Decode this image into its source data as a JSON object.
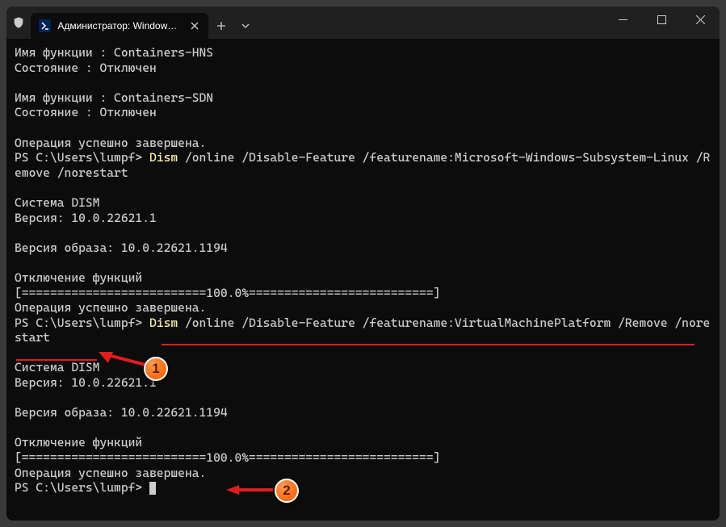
{
  "tab": {
    "title": "Администратор: Windows Po",
    "icon_label": "powershell-icon"
  },
  "window_controls": {
    "minimize": "—",
    "maximize": "▢",
    "close": "✕"
  },
  "annotations": {
    "bubble1": "1",
    "bubble2": "2"
  },
  "terminal": {
    "l1": "Имя функции : Containers-HNS",
    "l2": "Состояние : Отключен",
    "blank1": "",
    "l3": "Имя функции : Containers-SDN",
    "l4": "Состояние : Отключен",
    "blank2": "",
    "l5": "Операция успешно завершена.",
    "p1_prefix": "PS C:\\Users\\lumpf> ",
    "p1_cmd": "Dism",
    "p1_args": " /online /Disable-Feature /featurename:Microsoft-Windows-Subsystem-Linux /Remove /norestart",
    "blank3": "",
    "l6": "Cистема DISM",
    "l7": "Версия: 10.0.22621.1",
    "blank4": "",
    "l8": "Версия образа: 10.0.22621.1194",
    "blank5": "",
    "l9": "Отключение функций",
    "l10": "[==========================100.0%==========================]",
    "l11": "Операция успешно завершена.",
    "p2_prefix": "PS C:\\Users\\lumpf> ",
    "p2_cmd": "Dism",
    "p2_args": " /online /Disable-Feature /featurename:VirtualMachinePlatform /Remove /norestart",
    "blank6": "",
    "l12": "Cистема DISM",
    "l13": "Версия: 10.0.22621.1",
    "blank7": "",
    "l14": "Версия образа: 10.0.22621.1194",
    "blank8": "",
    "l15": "Отключение функций",
    "l16": "[==========================100.0%==========================]",
    "l17": "Операция успешно завершена.",
    "p3_prefix": "PS C:\\Users\\lumpf> "
  }
}
